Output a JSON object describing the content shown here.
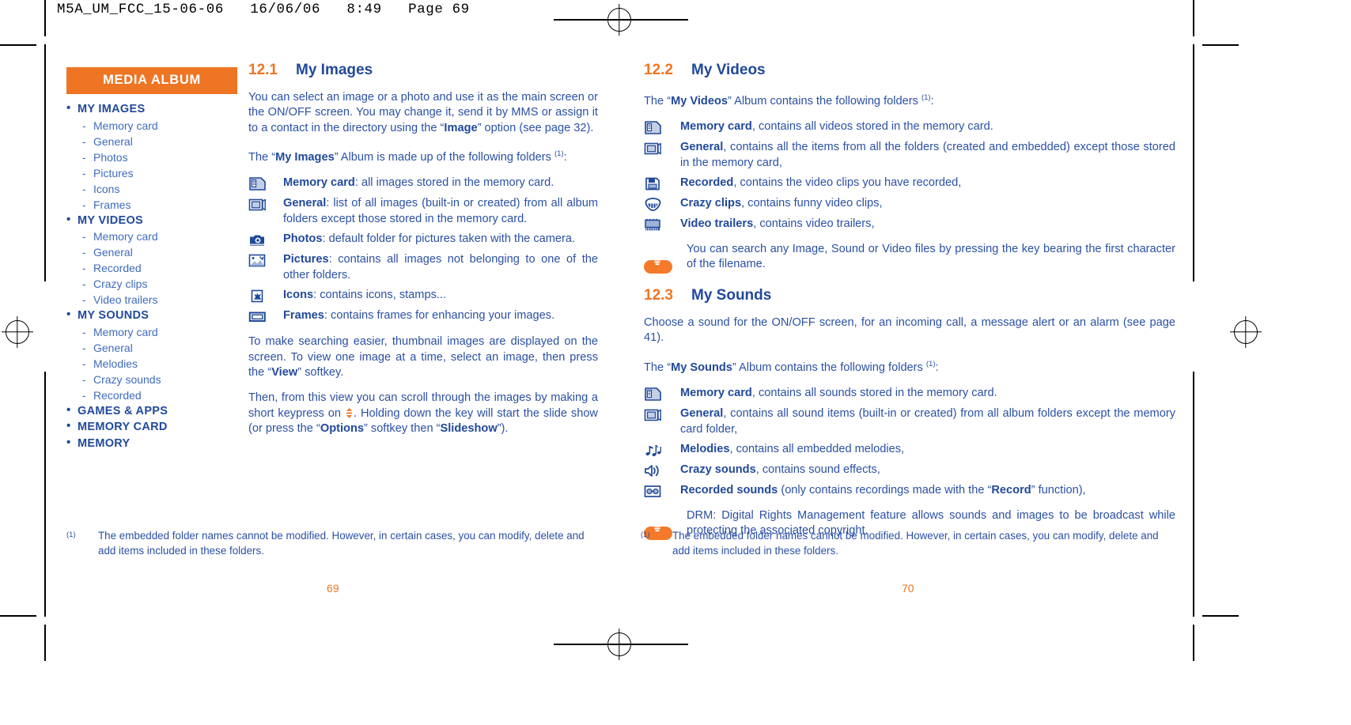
{
  "runhead": "M5A_UM_FCC_15-06-06   16/06/06   8:49   Page 69",
  "colors": {
    "orange": "#ee7523",
    "blue": "#21499a",
    "body_blue": "#2b50a4"
  },
  "sidebar": {
    "banner": "MEDIA ALBUM",
    "items": [
      {
        "label": "MY IMAGES",
        "children": [
          "Memory card",
          "General",
          "Photos",
          "Pictures",
          "Icons",
          "Frames"
        ]
      },
      {
        "label": "MY VIDEOS",
        "children": [
          "Memory card",
          "General",
          "Recorded",
          "Crazy clips",
          "Video trailers"
        ]
      },
      {
        "label": "MY SOUNDS",
        "children": [
          "Memory card",
          "General",
          "Melodies",
          "Crazy sounds",
          "Recorded"
        ]
      },
      {
        "label": "GAMES & APPS",
        "children": []
      },
      {
        "label": "MEMORY CARD",
        "children": []
      },
      {
        "label": "MEMORY",
        "children": []
      }
    ]
  },
  "left_page": {
    "section": {
      "number": "12.1",
      "title": "My Images"
    },
    "intro": "You can select an image or a photo and use it as the main screen or the ON/OFF screen. You may change it, send it by MMS or assign it to a contact in the directory using the “Image” option (see page 32).",
    "intro_parts": {
      "a": "You can select an image or a photo and use it as the main screen or the ON/OFF screen. You may change it, send it by MMS or assign it to a contact in the directory using the “",
      "bold": "Image",
      "b": "” option (see page 32)."
    },
    "list_lead": {
      "a": "The “",
      "bold": "My Images",
      "b": "” Album is made up of the following folders ",
      "sup": "(1)",
      "c": ":"
    },
    "folders": [
      {
        "icon": "memory-card-icon",
        "name": "Memory card",
        "sep": ": ",
        "desc": "all images stored in the memory card."
      },
      {
        "icon": "general-folder-icon",
        "name": "General",
        "sep": ": ",
        "desc": "list of all images (built-in or created) from all album folders except those stored in the memory card."
      },
      {
        "icon": "camera-icon",
        "name": "Photos",
        "sep": ": ",
        "desc": "default folder for pictures taken with the camera."
      },
      {
        "icon": "pictures-icon",
        "name": "Pictures",
        "sep": ": ",
        "desc": "contains all images not belonging to one of the other folders."
      },
      {
        "icon": "icons-stamps-icon",
        "name": "Icons",
        "sep": ": ",
        "desc": "contains icons, stamps..."
      },
      {
        "icon": "frames-icon",
        "name": "Frames",
        "sep": ": ",
        "desc": "contains frames for enhancing your images."
      }
    ],
    "para_thumbnail": {
      "a": "To make searching easier, thumbnail images are displayed on the screen. To view one image at a time, select an image, then press the “",
      "bold": "View",
      "b": "” softkey."
    },
    "para_scroll": {
      "a": "Then, from this view you can scroll through the images by making a short keypress on ",
      "b": ". Holding down the key will start the slide show (or press the “",
      "bold1": "Options",
      "c": "” softkey then “",
      "bold2": "Slideshow",
      "d": "”)."
    },
    "footnote": {
      "mark": "(1)",
      "text": "The embedded folder names cannot be modified. However, in certain cases, you can modify, delete and add items included in these folders."
    },
    "folio": "69"
  },
  "right_page": {
    "section_videos": {
      "number": "12.2",
      "title": "My Videos"
    },
    "videos_lead": {
      "a": "The “",
      "bold": "My Videos",
      "b": "” Album contains the following folders ",
      "sup": "(1)",
      "c": ":"
    },
    "videos_folders": [
      {
        "icon": "memory-card-icon",
        "name": "Memory card",
        "sep": ", ",
        "desc": "contains all videos stored in the memory card."
      },
      {
        "icon": "general-folder-icon",
        "name": "General",
        "sep": ", ",
        "desc": "contains all the items from all the folders (created and embedded) except those stored in the memory card,"
      },
      {
        "icon": "recorded-icon",
        "name": "Recorded",
        "sep": ", ",
        "desc": "contains the video clips you have recorded,"
      },
      {
        "icon": "crazy-clips-icon",
        "name": "Crazy clips",
        "sep": ", ",
        "desc": "contains funny video clips,"
      },
      {
        "icon": "video-trailers-icon",
        "name": "Video trailers",
        "sep": ", ",
        "desc": "contains video trailers,"
      }
    ],
    "tip_videos": "You can search any Image, Sound or Video files by pressing the key bearing the first character of the filename.",
    "section_sounds": {
      "number": "12.3",
      "title": "My Sounds"
    },
    "sounds_intro": "Choose a sound for the ON/OFF screen, for an incoming call, a message alert or an alarm (see page 41).",
    "sounds_lead": {
      "a": "The “",
      "bold": "My Sounds",
      "b": "” Album contains the following folders ",
      "sup": "(1)",
      "c": ":"
    },
    "sounds_folders": [
      {
        "icon": "memory-card-icon",
        "name": "Memory card",
        "sep": ", ",
        "desc": "contains all sounds stored in the memory card."
      },
      {
        "icon": "general-folder-icon",
        "name": "General",
        "sep": ", ",
        "desc": "contains all sound items (built-in or created) from all album folders except the memory card folder,"
      },
      {
        "icon": "melodies-icon",
        "name": "Melodies",
        "sep": ", ",
        "desc": "contains all embedded melodies,"
      },
      {
        "icon": "crazy-sounds-icon",
        "name": "Crazy sounds",
        "sep": ", ",
        "desc": "contains sound effects,"
      },
      {
        "icon": "recorded-sounds-icon",
        "name": "Recorded sounds",
        "sep": " ",
        "desc_a": "(only contains recordings made with the “",
        "desc_bold": "Record",
        "desc_b": "” function),"
      }
    ],
    "tip_drm": "DRM: Digital Rights Management feature allows sounds and images to be broadcast while protecting the associated copyright.",
    "footnote": {
      "mark": "(1)",
      "text": "The embedded folder names cannot be modified. However, in certain cases, you can modify, delete and add items included in these folders."
    },
    "folio": "70"
  }
}
